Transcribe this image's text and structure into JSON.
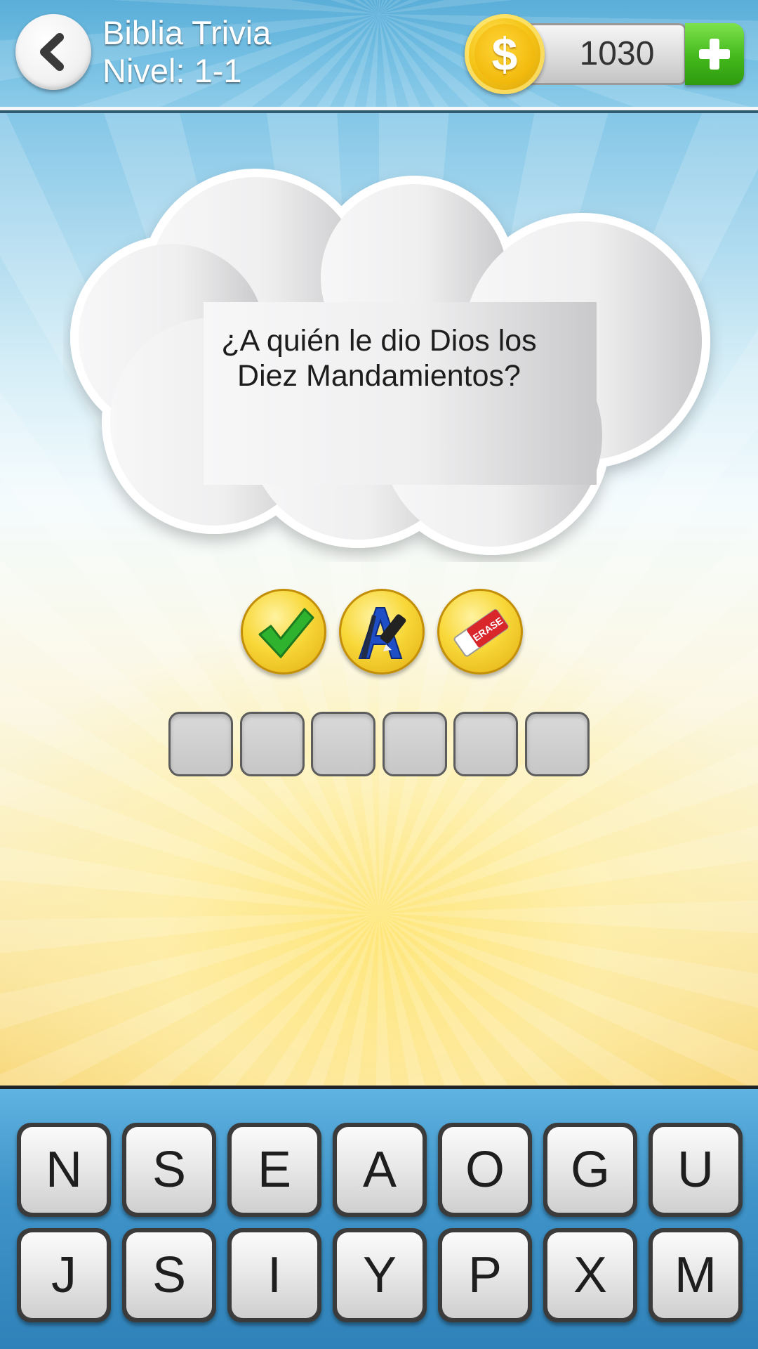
{
  "header": {
    "app_title": "Biblia Trivia",
    "level_label": "Nivel: 1-1",
    "coins": "1030",
    "coin_symbol": "$"
  },
  "question": {
    "line1": "¿A quién le dio Dios los",
    "line2": "Diez Mandamientos?"
  },
  "powerups": [
    {
      "icon": "check-icon"
    },
    {
      "icon": "reveal-letter-icon"
    },
    {
      "icon": "eraser-icon",
      "text": "ERASE"
    }
  ],
  "answer": {
    "slots": [
      "",
      "",
      "",
      "",
      "",
      ""
    ]
  },
  "keyboard": {
    "row1": [
      "N",
      "S",
      "E",
      "A",
      "O",
      "G",
      "U"
    ],
    "row2": [
      "J",
      "S",
      "I",
      "Y",
      "P",
      "X",
      "M"
    ]
  },
  "colors": {
    "accent_blue": "#5aaed8",
    "coin_gold": "#f5c518",
    "add_green": "#43b81c"
  }
}
